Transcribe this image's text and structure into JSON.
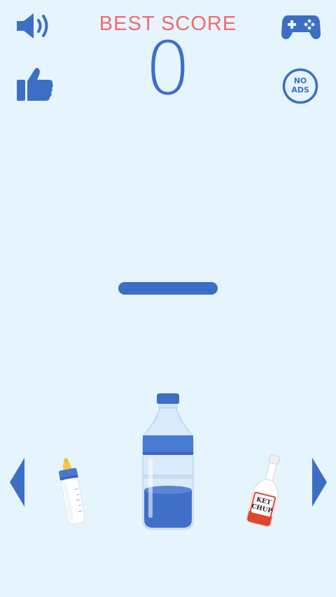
{
  "header": {
    "best_score_label": "BEST SCORE",
    "score": "0"
  },
  "buttons": {
    "sound_icon": "speaker-icon",
    "like_icon": "thumbs-up-icon",
    "games_icon": "gamepad-icon",
    "no_ads_line1": "NO",
    "no_ads_line2": "ADS"
  },
  "bottle_selector": {
    "left_bottle": "baby-bottle",
    "center_bottle": "water-bottle",
    "right_bottle": "ketchup-bottle",
    "ketchup_label_line1": "KET",
    "ketchup_label_line2": "CHUP"
  },
  "colors": {
    "background": "#e6f4fd",
    "accent_blue": "#3c6fc4",
    "best_score_red": "#ef6b6f"
  }
}
